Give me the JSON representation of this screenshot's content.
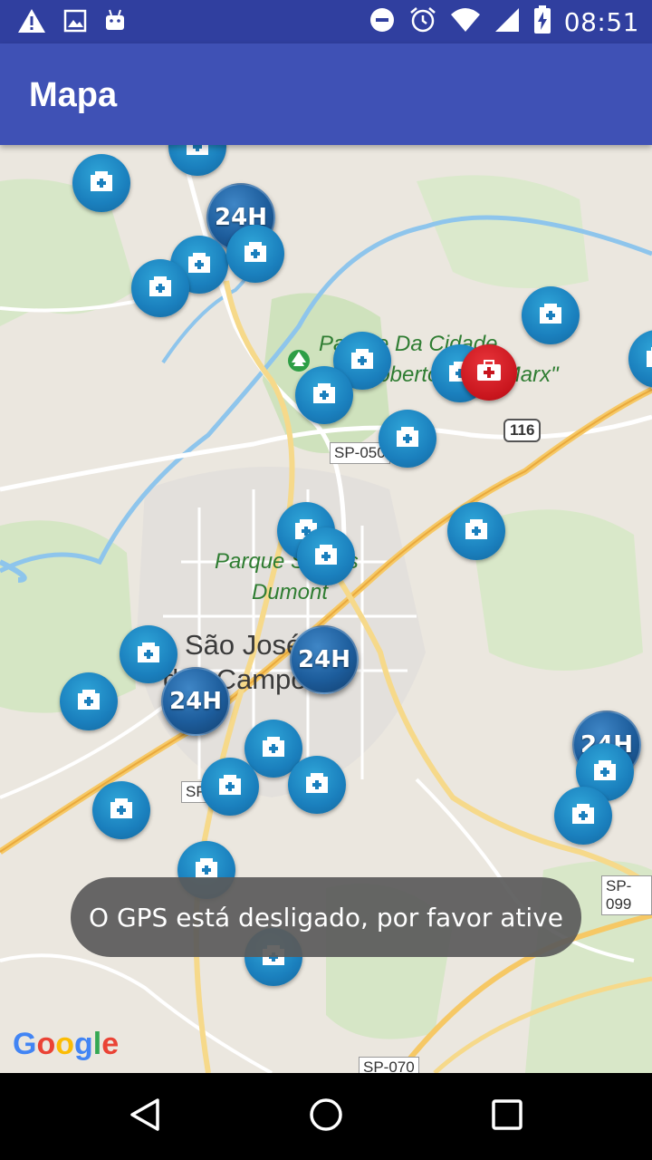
{
  "status_bar": {
    "time": "08:51",
    "left_icons": [
      "warning-icon",
      "image-icon",
      "android-icon"
    ],
    "right_icons": [
      "do-not-disturb-icon",
      "alarm-icon",
      "wifi-icon",
      "signal-icon",
      "battery-charging-icon"
    ]
  },
  "app_bar": {
    "title": "Mapa",
    "color": "#3f51b5",
    "status_color": "#303f9f"
  },
  "map": {
    "park_label_1_line1": "Parque Da Cidade",
    "park_label_1_line2": "Roberto Burle Marx\"",
    "park_label_2_line1": "Parque Santos",
    "park_label_2_line2": "Dumont",
    "city_line1": "São José",
    "city_line2": "dos Campos",
    "road_sp050": "SP-050",
    "road_116": "116",
    "road_sp099": "SP-099",
    "road_sp070": "SP-070",
    "road_sp_partial": "SP",
    "marker_24h_label": "24H",
    "google_logo": "Google"
  },
  "toast": {
    "message": "O GPS está desligado, por favor ative"
  },
  "nav_bar": {
    "back": "back-icon",
    "home": "home-icon",
    "recents": "recents-icon"
  }
}
